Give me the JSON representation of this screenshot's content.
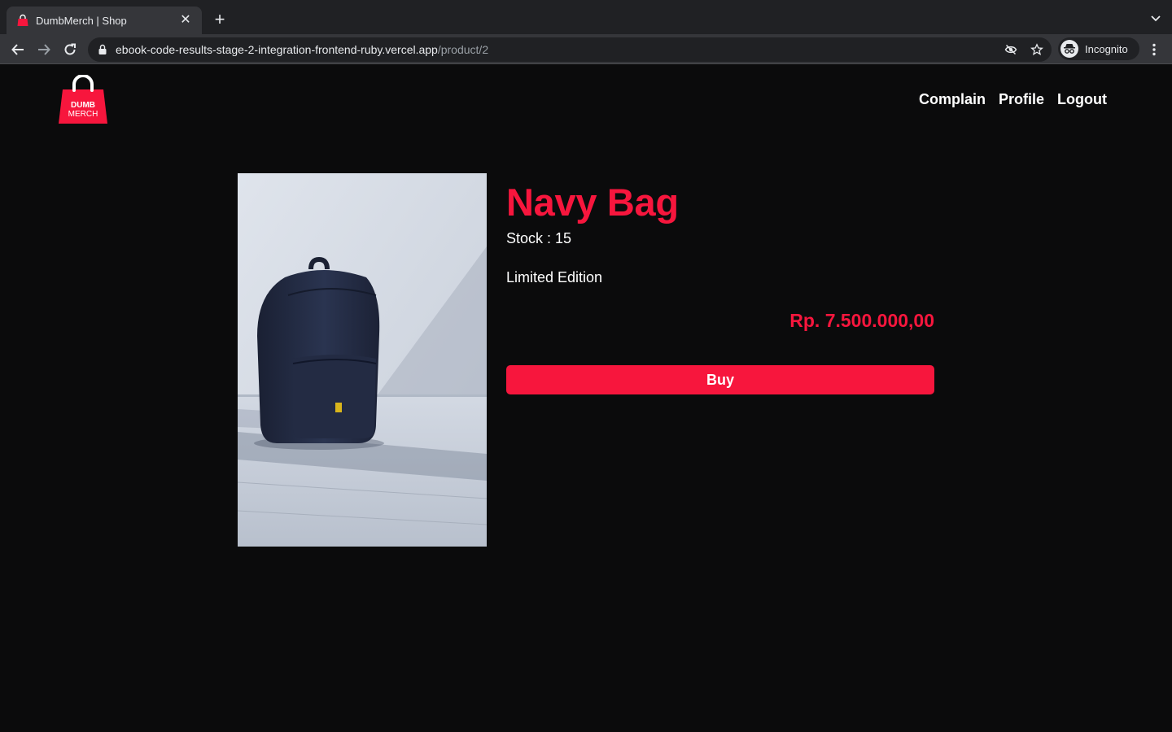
{
  "browser": {
    "tab_title": "DumbMerch | Shop",
    "url_host": "ebook-code-results-stage-2-integration-frontend-ruby.vercel.app",
    "url_path": "/product/2",
    "profile_label": "Incognito"
  },
  "header": {
    "logo_text": [
      "DUMB",
      "MERCH"
    ],
    "nav": [
      "Complain",
      "Profile",
      "Logout"
    ]
  },
  "product": {
    "name": "Navy Bag",
    "stock_label": "Stock :",
    "stock": "15",
    "description": "Limited Edition",
    "price": "Rp. 7.500.000,00",
    "buy_label": "Buy"
  },
  "colors": {
    "accent": "#f7163d",
    "background": "#0b0b0c",
    "text": "#ffffff"
  },
  "icons": {
    "back": "arrow-left-icon",
    "forward": "arrow-right-icon",
    "reload": "reload-icon",
    "lock": "lock-icon",
    "eye_off": "eye-off-icon",
    "star": "star-icon",
    "incognito": "incognito-icon",
    "menu": "kebab-menu-icon"
  }
}
